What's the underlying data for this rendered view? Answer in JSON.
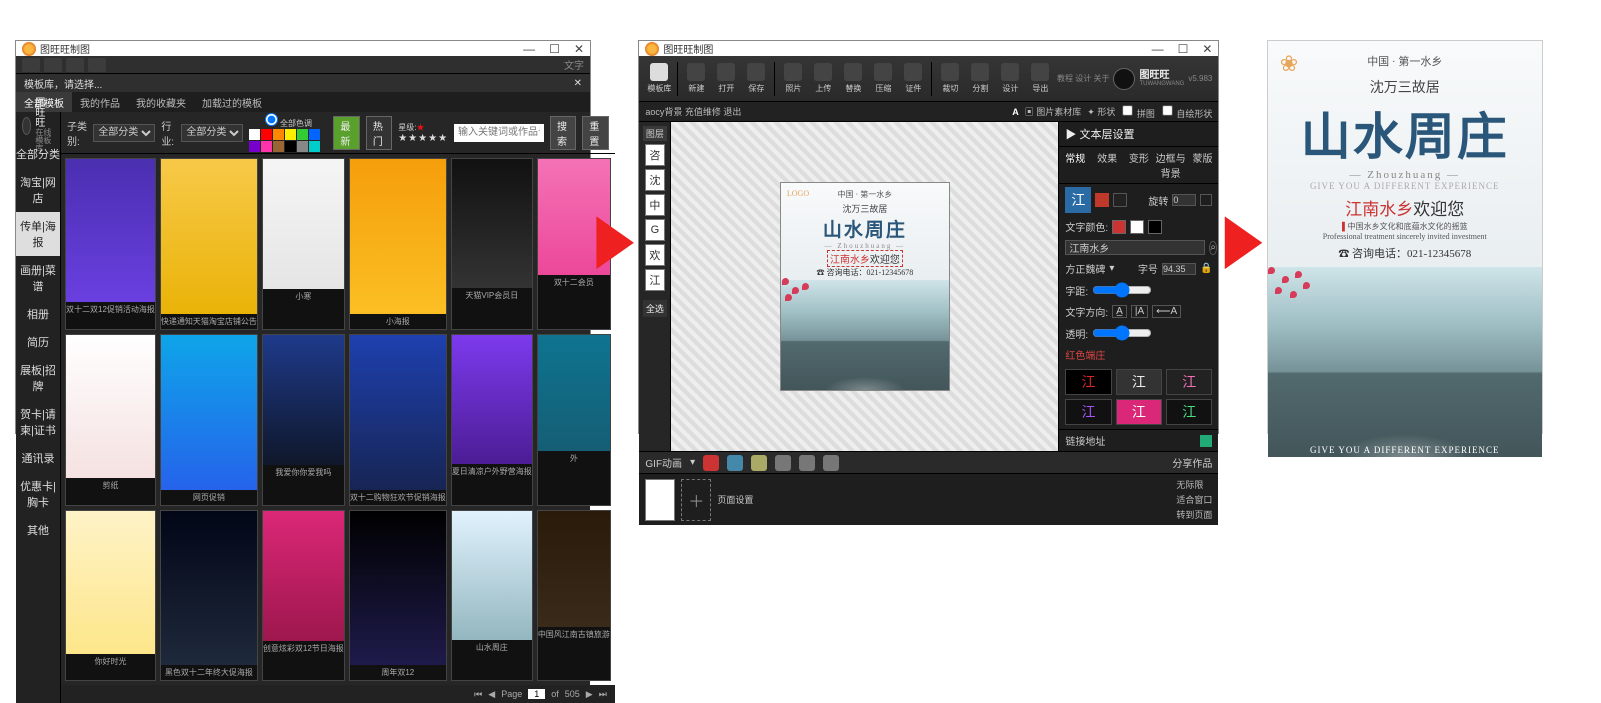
{
  "app_title": "图旺旺制图",
  "win1": {
    "crumb": "模板库，请选择...",
    "tabs": [
      "全部模板",
      "我的作品",
      "我的收藏夹",
      "加载过的模板"
    ],
    "brand_small": "图旺旺",
    "brand_sub": "在线模板库",
    "categories": [
      "全部分类",
      "淘宝|网店",
      "传单|海报",
      "画册|菜谱",
      "相册",
      "简历",
      "展板|招牌",
      "贺卡|请柬|证书",
      "通讯录",
      "优惠卡|胸卡",
      "其他"
    ],
    "active_category_idx": 2,
    "filter_labels": {
      "child": "子类别:",
      "industry": "行业:",
      "color": "全部色调",
      "star": "星级:",
      "latest": "最新",
      "hot": "热门",
      "search": "搜索",
      "reset": "重置"
    },
    "child_select": "全部分类",
    "industry_select": "全部分类",
    "search_placeholder": "输入关键词或作品号",
    "swatches": [
      "#ffffff",
      "#ff0000",
      "#ff8800",
      "#ffee00",
      "#33cc33",
      "#0066ff",
      "#7700cc",
      "#ff33aa",
      "#996633",
      "#000000",
      "#888888",
      "#00cccc"
    ],
    "thumbnails": [
      {
        "cap": "双十二双12促销活动海报",
        "bg": "linear-gradient(#4a2fb0,#6a3fe0)"
      },
      {
        "cap": "快递通知天猫淘宝店铺公告",
        "bg": "linear-gradient(#f7c948,#eab308)"
      },
      {
        "cap": "小寒",
        "bg": "linear-gradient(#f5f5f5,#e5e5e5)"
      },
      {
        "cap": "小海报",
        "bg": "linear-gradient(#f59e0b,#fbbf24)"
      },
      {
        "cap": "天猫VIP会员日",
        "bg": "linear-gradient(#111,#333)"
      },
      {
        "cap": "双十二会员",
        "bg": "linear-gradient(#f472b6,#ec4899)"
      },
      {
        "cap": "剪纸",
        "bg": "linear-gradient(#fff,#f5e1e1)"
      },
      {
        "cap": "网页促销",
        "bg": "linear-gradient(#0ea5e9,#2563eb)"
      },
      {
        "cap": "我爱你你爱我吗",
        "bg": "linear-gradient(#1e3a8a,#0f172a)"
      },
      {
        "cap": "双十二购物狂欢节促销海报",
        "bg": "linear-gradient(#1e40af,#172554)"
      },
      {
        "cap": "夏日清凉户外野营海报",
        "bg": "linear-gradient(#7c3aed,#4c1d95)"
      },
      {
        "cap": "外 ",
        "bg": "linear-gradient(#0e7490,#155e75)"
      },
      {
        "cap": "你好时光",
        "bg": "linear-gradient(#fef3c7,#fde68a)"
      },
      {
        "cap": "黑色双十二年终大促海报",
        "bg": "linear-gradient(#020617,#1e293b)"
      },
      {
        "cap": "创意炫彩双12节日海报",
        "bg": "linear-gradient(#db2777,#9d174d)"
      },
      {
        "cap": "周年双12",
        "bg": "linear-gradient(#000,#1e1b4b)"
      },
      {
        "cap": "山水周庄",
        "bg": "linear-gradient(#e0f2fe,#94b7bf)"
      },
      {
        "cap": "中国风江南古镇旅游",
        "bg": "linear-gradient(#2a1a0a,#3a2a1a)"
      }
    ],
    "pager": {
      "page_label": "Page",
      "page": "1",
      "of": "of",
      "total": "505"
    }
  },
  "win2": {
    "ribbon": [
      {
        "k": "home",
        "label": "模板库"
      },
      {
        "k": "new",
        "label": "新建"
      },
      {
        "k": "open",
        "label": "打开"
      },
      {
        "k": "save",
        "label": "保存"
      },
      {
        "k": "photo",
        "label": "照片"
      },
      {
        "k": "undo",
        "label": "上传"
      },
      {
        "k": "swap",
        "label": "替换"
      },
      {
        "k": "zip",
        "label": "压缩"
      },
      {
        "k": "id",
        "label": "证件"
      },
      {
        "k": "cut",
        "label": "裁切"
      },
      {
        "k": "pick",
        "label": "分割"
      },
      {
        "k": "screen",
        "label": "设计"
      },
      {
        "k": "gear",
        "label": "导出"
      }
    ],
    "brand": "图旺旺",
    "brand_en": "TUWANGWANG",
    "version": "v5.983",
    "top_links": [
      "教程",
      "设计",
      "关于"
    ],
    "subbar": {
      "file": "aocy背景 充值维修 退出",
      "btn_a": "A",
      "btn_pic": "图片素材库",
      "btn_shape": "形状",
      "chk_puzzle": "拼图",
      "chk_auto": "自绘形状"
    },
    "layers_header": "图层",
    "layers": [
      "咨",
      "沈",
      "中",
      "G",
      "欢",
      "江"
    ],
    "layers_select": "全选",
    "gif_label": "GIF动画",
    "lock_icons": 6,
    "share": "分享作品",
    "page_label": "页面设置",
    "thumb_right": [
      "无际限",
      "适合窗口",
      "转到页面"
    ],
    "props": {
      "title": "▶ 文本层设置",
      "tabs": [
        "常规",
        "效果",
        "变形",
        "边框与背景",
        "蒙版"
      ],
      "sample": "江",
      "font_dropdown": "旋转",
      "deg": "0",
      "color_label": "文字颜色:",
      "text_value": "江南水乡",
      "align_label": "方正魏碑",
      "size_label": "字号",
      "size_value": "94.35",
      "spacing_label": "字距:",
      "dir_label": "文字方向:",
      "alpha_label": "透明:",
      "preset_label": "红色端庄",
      "presets": [
        {
          "t": "江",
          "c": "#dc2626",
          "bg": "#000"
        },
        {
          "t": "江",
          "c": "#eee",
          "bg": "#333"
        },
        {
          "t": "江",
          "c": "#f472b6",
          "bg": "#222"
        },
        {
          "t": "江",
          "c": "#a855f7",
          "bg": "#111"
        },
        {
          "t": "江",
          "c": "#fff",
          "bg": "#db2777"
        },
        {
          "t": "江",
          "c": "#4ade80",
          "bg": "#111"
        }
      ],
      "link_label": "链接地址"
    }
  },
  "poster": {
    "badge": "❀",
    "tag": "中国 · 第一水乡",
    "subtitle": "沈万三故居",
    "title": "山水周庄",
    "en": "— Zhouzhuang —",
    "diff": "GIVE YOU A DIFFERENT EXPERIENCE",
    "welcome_hi": "江南水乡",
    "welcome_rest": "欢迎您",
    "info1": "中国水乡文化和底蕴水文化的摇篮",
    "info2": "Professional treatment  sincerely invited investment",
    "phone": "☎ 咨询电话：021-12345678",
    "logo_small": "LOGO",
    "foot": "GIVE YOU A DIFFERENT EXPERIENCE"
  }
}
